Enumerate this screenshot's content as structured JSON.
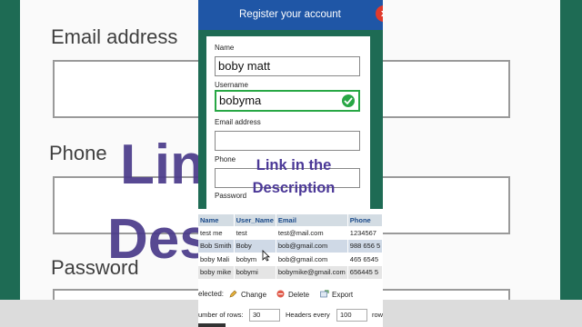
{
  "header": {
    "title": "Register your account",
    "close_label": "x"
  },
  "form": {
    "name_label": "Name",
    "name_value": "boby matt",
    "username_label": "Username",
    "username_value": "bobyma",
    "email_label": "Email address",
    "email_value": "",
    "phone_label": "Phone",
    "phone_value": "",
    "password_label": "Password"
  },
  "overlay": {
    "line1": "Link in the",
    "line2": "Description"
  },
  "background": {
    "email_label": "Email address",
    "phone_label": "Phone",
    "password_label": "Password",
    "purple_top": "Link",
    "purple_bottom": "Desc"
  },
  "table": {
    "columns": [
      "Name",
      "User_Name",
      "Email",
      "Phone"
    ],
    "rows": [
      [
        "test me",
        "test",
        "test@mail.com",
        "1234567"
      ],
      [
        "Bob Smith",
        "Boby",
        "bob@gmail.com",
        "988 656 5"
      ],
      [
        "boby Mali",
        "bobym",
        "bob@gmail.com",
        "465 6545"
      ],
      [
        "boby mike",
        "bobymi",
        "bobymike@gmail.com",
        "656445 5"
      ]
    ]
  },
  "actions": {
    "selected_label": "elected:",
    "change_label": "Change",
    "delete_label": "Delete",
    "export_label": "Export"
  },
  "pager": {
    "rows_label": "umber of rows:",
    "rows_value": "30",
    "headers_label": "Headers every",
    "headers_value": "100",
    "tail_label": "row"
  },
  "colors": {
    "header_blue": "#1f56a6",
    "form_green": "#1e6b54",
    "valid_green": "#28a745",
    "overlay_purple": "#4b3897",
    "close_red": "#e03a2c"
  }
}
